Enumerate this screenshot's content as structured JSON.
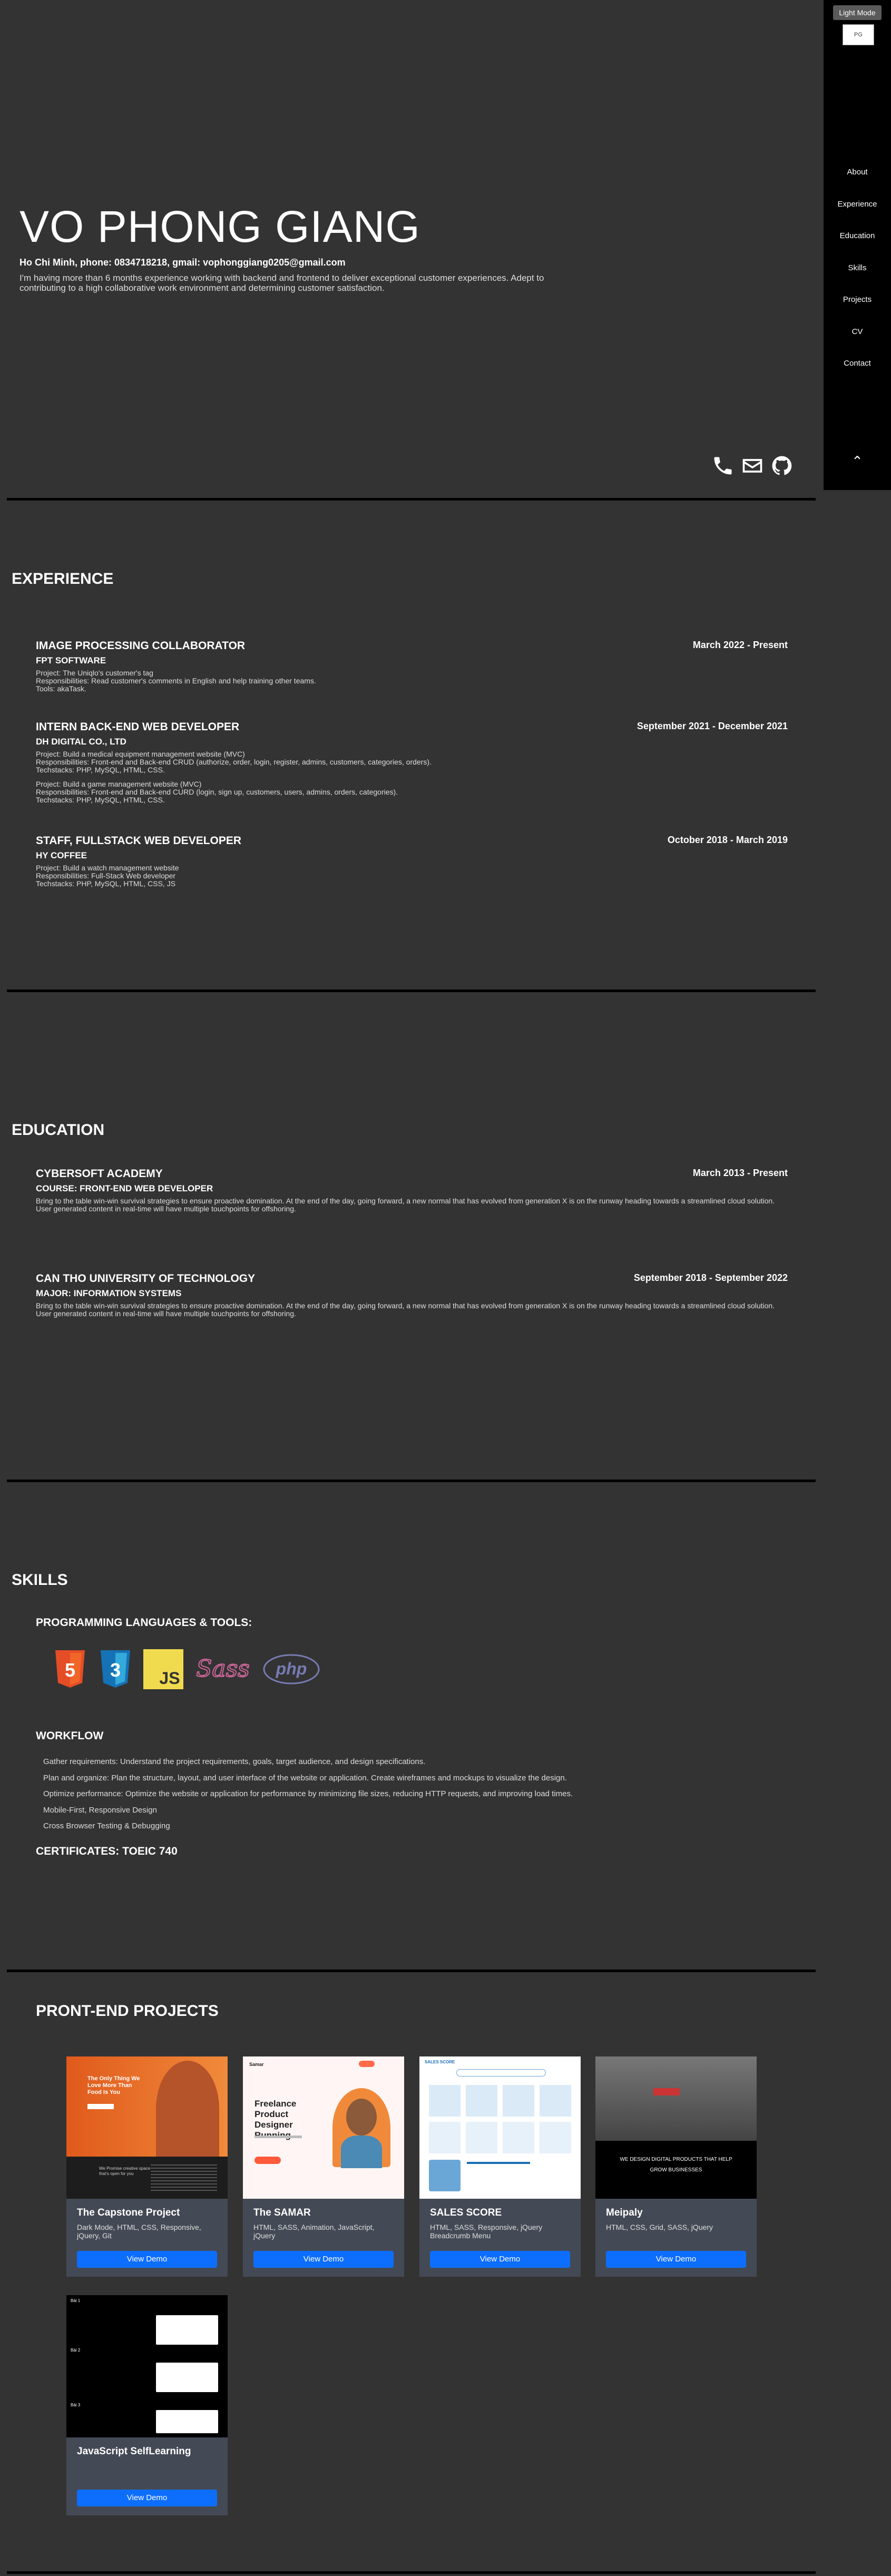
{
  "sidebar": {
    "mode_button": "Light Mode",
    "avatar_alt": "PG",
    "nav": [
      "About",
      "Experience",
      "Education",
      "Skills",
      "Projects",
      "CV",
      "Contact"
    ]
  },
  "hero": {
    "name": "VO PHONG GIANG",
    "contact": "Ho Chi Minh, phone: 0834718218, gmail: vophonggiang0205@gmail.com",
    "desc": "I'm having more than 6 months experience working with backend and frontend to deliver exceptional customer experiences. Adept to contributing to a high collaborative work environment and determining customer satisfaction."
  },
  "experience": {
    "heading": "EXPERIENCE",
    "items": [
      {
        "title": "IMAGE PROCESSING COLLABORATOR",
        "date": "March 2022 - Present",
        "company": "FPT SOFTWARE",
        "lines": [
          "Project: The Uniqlo's customer's tag",
          "Responsibilities: Read customer's comments in English and help training other teams.",
          "Tools: akaTask."
        ]
      },
      {
        "title": "INTERN BACK-END WEB DEVELOPER",
        "date": "September 2021 - December 2021",
        "company": "DH DIGITAL CO., LTD",
        "lines": [
          "Project: Build a medical equipment management website (MVC)",
          "Responsibilities: Front-end and Back-end CRUD (authorize, order, login, register, admins, customers, categories, orders).",
          "Techstacks: PHP, MySQL, HTML, CSS."
        ],
        "lines2": [
          "Project: Build a game management website (MVC)",
          "Responsibilities: Front-end and Back-end CURD (login, sign up, customers, users, admins, orders, categories).",
          "Techstacks: PHP, MySQL, HTML, CSS."
        ]
      },
      {
        "title": "STAFF, FULLSTACK WEB DEVELOPER",
        "date": "October 2018 - March 2019",
        "company": "HY COFFEE",
        "lines": [
          "Project: Build a watch management website",
          "Responsibilities: Full-Stack Web developer",
          "Techstacks: PHP, MySQL, HTML, CSS, JS"
        ]
      }
    ]
  },
  "education": {
    "heading": "EDUCATION",
    "items": [
      {
        "title": "CYBERSOFT ACADEMY",
        "date": "March 2013 - Present",
        "sub": "COURSE: FRONT-END WEB DEVELOPER",
        "desc": "Bring to the table win-win survival strategies to ensure proactive domination. At the end of the day, going forward, a new normal that has evolved from generation X is on the runway heading towards a streamlined cloud solution. User generated content in real-time will have multiple touchpoints for offshoring."
      },
      {
        "title": "CAN THO UNIVERSITY OF TECHNOLOGY",
        "date": "September 2018 - September 2022",
        "sub": "MAJOR: INFORMATION SYSTEMS",
        "desc": "Bring to the table win-win survival strategies to ensure proactive domination. At the end of the day, going forward, a new normal that has evolved from generation X is on the runway heading towards a streamlined cloud solution. User generated content in real-time will have multiple touchpoints for offshoring."
      }
    ]
  },
  "skills": {
    "heading": "SKILLS",
    "sub": "PROGRAMMING LANGUAGES & TOOLS:",
    "logos": [
      "html5-icon",
      "css3-icon",
      "js-icon",
      "sass-icon",
      "php-icon"
    ],
    "js_text": "JS",
    "sass_text": "Sass",
    "php_text": "php",
    "html_num": "5",
    "css_num": "3",
    "workflow_heading": "WORKFLOW",
    "workflow": [
      "Gather requirements: Understand the project requirements, goals, target audience, and design specifications.",
      "Plan and organize: Plan the structure, layout, and user interface of the website or application. Create wireframes and mockups to visualize the design.",
      "Optimize performance: Optimize the website or application for performance by minimizing file sizes, reducing HTTP requests, and improving load times.",
      "Mobile-First, Responsive Design",
      "Cross Browser Testing & Debugging"
    ],
    "certificates": "CERTIFICATES: TOEIC 740"
  },
  "projects": {
    "heading": "PRONT-END PROJECTS",
    "button": "View Demo",
    "cards": [
      {
        "title": "The Capstone Project",
        "tags": "Dark Mode, HTML, CSS, Responsive, jQuery, Git"
      },
      {
        "title": "The SAMAR",
        "tags": "HTML, SASS, Animation, JavaScript, jQuery"
      },
      {
        "title": "SALES SCORE",
        "tags": "HTML, SASS, Responsive, jQuery Breadcrumb Menu"
      },
      {
        "title": "Meipaly",
        "tags": "HTML, CSS, Grid, SASS, jQuery"
      },
      {
        "title": "JavaScript SelfLearning",
        "tags": ""
      }
    ],
    "thumb1": {
      "hero": "The Only Thing We Love More Than Food Is You",
      "sub": "We Promise creative space that's open for you"
    },
    "thumb2": {
      "brand": "Samar",
      "hero": "Freelance Product Designer Running"
    },
    "thumb3": {
      "brand": "SALES SCORE"
    },
    "thumb4": {
      "hero": "WE DESIGN DIGITAL PRODUCTS THAT HELP GROW BUSINESSES"
    },
    "thumb5": {
      "l1": "Bài 1",
      "l2": "Bài 2",
      "l3": "Bài 3"
    }
  }
}
